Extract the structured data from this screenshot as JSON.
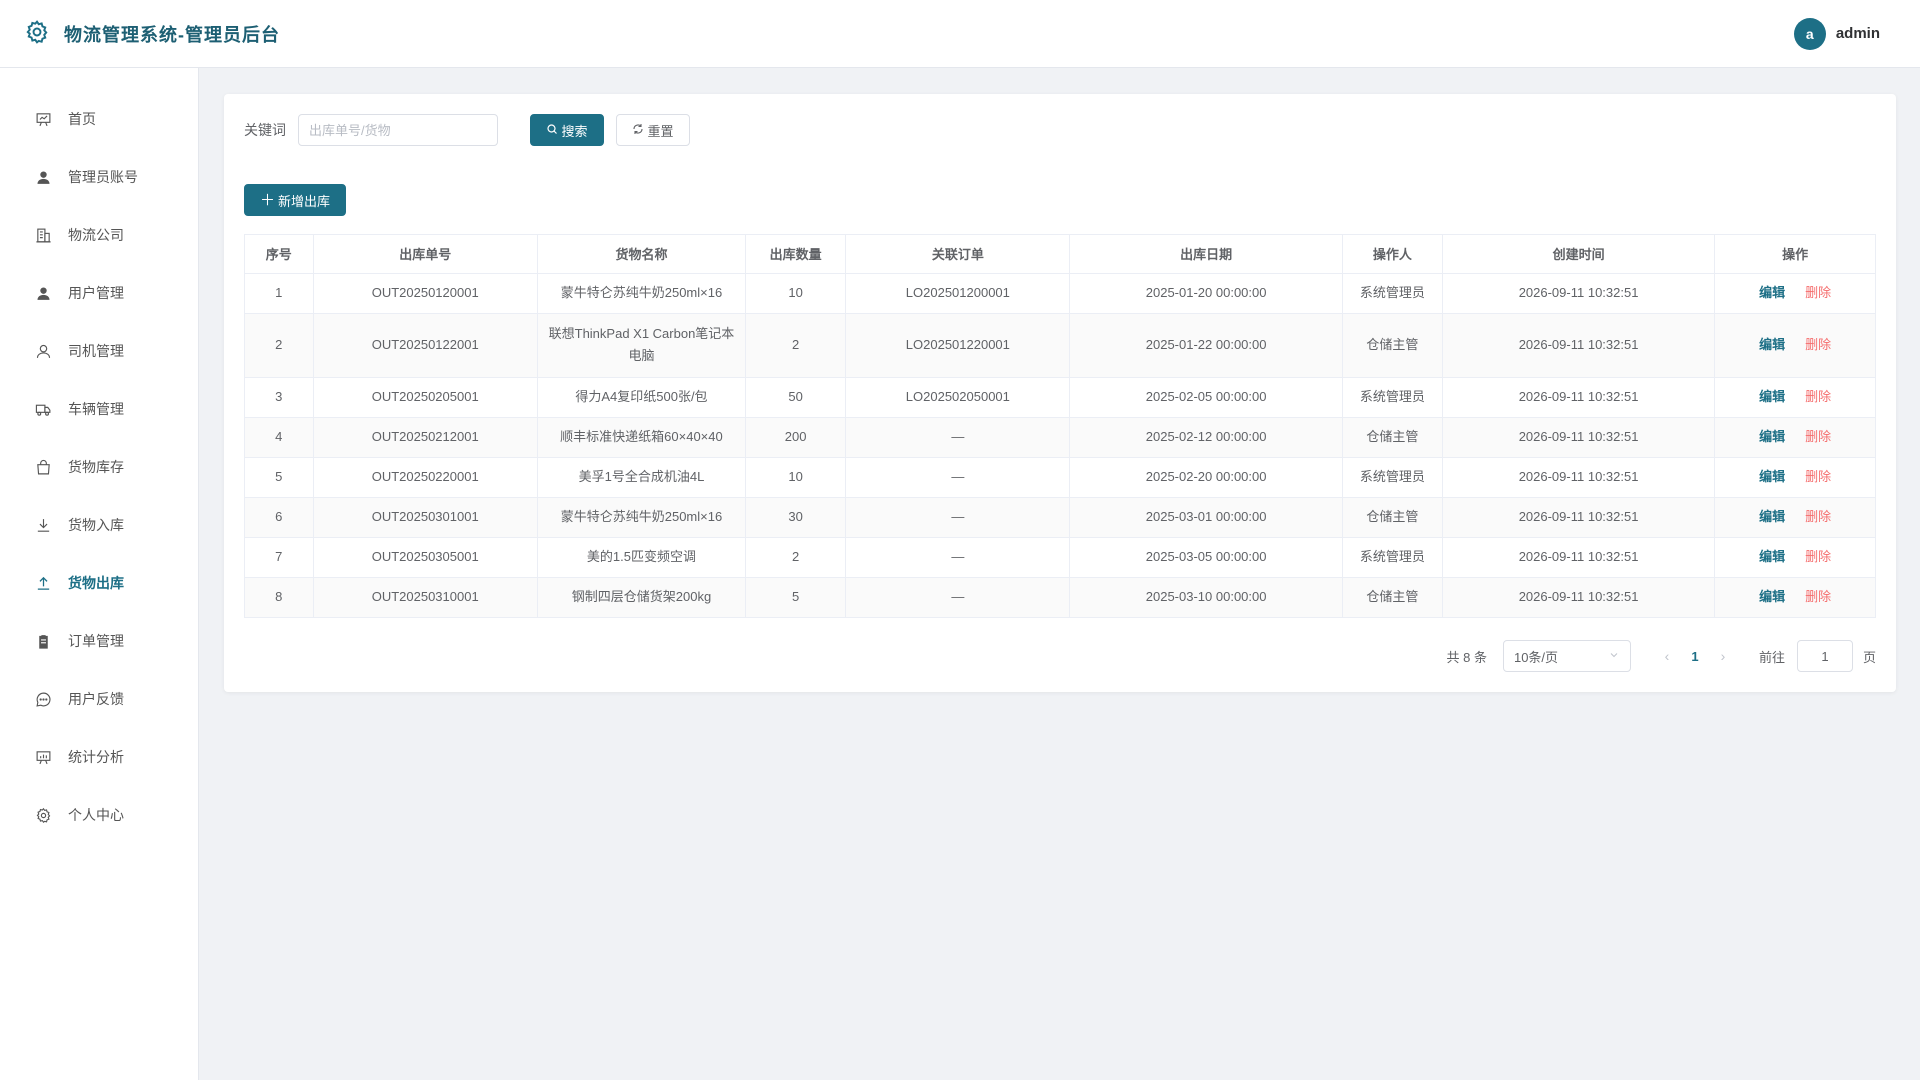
{
  "header": {
    "title": "物流管理系统-管理员后台",
    "avatar_letter": "a",
    "username": "admin"
  },
  "sidebar": {
    "items": [
      {
        "label": "首页",
        "icon": "dashboard-icon"
      },
      {
        "label": "管理员账号",
        "icon": "user-solid-icon"
      },
      {
        "label": "物流公司",
        "icon": "building-icon"
      },
      {
        "label": "用户管理",
        "icon": "user-solid-icon"
      },
      {
        "label": "司机管理",
        "icon": "user-outline-icon"
      },
      {
        "label": "车辆管理",
        "icon": "truck-icon"
      },
      {
        "label": "货物库存",
        "icon": "bag-icon"
      },
      {
        "label": "货物入库",
        "icon": "download-icon"
      },
      {
        "label": "货物出库",
        "icon": "upload-icon",
        "active": true
      },
      {
        "label": "订单管理",
        "icon": "clipboard-icon"
      },
      {
        "label": "用户反馈",
        "icon": "chat-icon"
      },
      {
        "label": "统计分析",
        "icon": "chart-board-icon"
      },
      {
        "label": "个人中心",
        "icon": "gear-icon"
      }
    ]
  },
  "search": {
    "label": "关键词",
    "placeholder": "出库单号/货物",
    "value": "",
    "search_button": "搜索",
    "reset_button": "重置"
  },
  "add_button": "新增出库",
  "table": {
    "columns": [
      "序号",
      "出库单号",
      "货物名称",
      "出库数量",
      "关联订单",
      "出库日期",
      "操作人",
      "创建时间",
      "操作"
    ],
    "rows": [
      {
        "no": "1",
        "code": "OUT20250120001",
        "goods": "蒙牛特仑苏纯牛奶250ml×16",
        "qty": "10",
        "order": "LO202501200001",
        "date": "2025-01-20 00:00:00",
        "operator": "系统管理员",
        "created": "2026-09-11 10:32:51"
      },
      {
        "no": "2",
        "code": "OUT20250122001",
        "goods": "联想ThinkPad X1 Carbon笔记本电脑",
        "qty": "2",
        "order": "LO202501220001",
        "date": "2025-01-22 00:00:00",
        "operator": "仓储主管",
        "created": "2026-09-11 10:32:51"
      },
      {
        "no": "3",
        "code": "OUT20250205001",
        "goods": "得力A4复印纸500张/包",
        "qty": "50",
        "order": "LO202502050001",
        "date": "2025-02-05 00:00:00",
        "operator": "系统管理员",
        "created": "2026-09-11 10:32:51"
      },
      {
        "no": "4",
        "code": "OUT20250212001",
        "goods": "顺丰标准快递纸箱60×40×40",
        "qty": "200",
        "order": "—",
        "date": "2025-02-12 00:00:00",
        "operator": "仓储主管",
        "created": "2026-09-11 10:32:51"
      },
      {
        "no": "5",
        "code": "OUT20250220001",
        "goods": "美孚1号全合成机油4L",
        "qty": "10",
        "order": "—",
        "date": "2025-02-20 00:00:00",
        "operator": "系统管理员",
        "created": "2026-09-11 10:32:51"
      },
      {
        "no": "6",
        "code": "OUT20250301001",
        "goods": "蒙牛特仑苏纯牛奶250ml×16",
        "qty": "30",
        "order": "—",
        "date": "2025-03-01 00:00:00",
        "operator": "仓储主管",
        "created": "2026-09-11 10:32:51"
      },
      {
        "no": "7",
        "code": "OUT20250305001",
        "goods": "美的1.5匹变频空调",
        "qty": "2",
        "order": "—",
        "date": "2025-03-05 00:00:00",
        "operator": "系统管理员",
        "created": "2026-09-11 10:32:51"
      },
      {
        "no": "8",
        "code": "OUT20250310001",
        "goods": "钢制四层仓储货架200kg",
        "qty": "5",
        "order": "—",
        "date": "2025-03-10 00:00:00",
        "operator": "仓储主管",
        "created": "2026-09-11 10:32:51"
      }
    ],
    "edit_label": "编辑",
    "delete_label": "删除"
  },
  "pagination": {
    "total_text": "共 8 条",
    "page_size": "10条/页",
    "current_page": "1",
    "goto_label": "前往",
    "goto_value": "1",
    "page_suffix": "页"
  },
  "colors": {
    "accent": "#1d6f86",
    "danger": "#f56c6c",
    "background": "#f0f2f5"
  }
}
